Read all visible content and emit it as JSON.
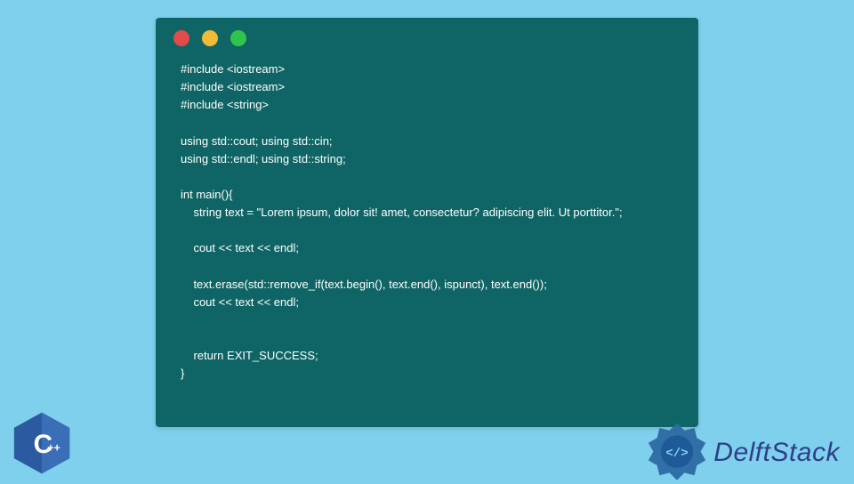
{
  "window": {
    "dot_colors": {
      "red": "#e24b4b",
      "yellow": "#f0bb36",
      "green": "#2fc54c"
    }
  },
  "code_lines": "#include <iostream>\n#include <iostream>\n#include <string>\n\nusing std::cout; using std::cin;\nusing std::endl; using std::string;\n\nint main(){\n    string text = \"Lorem ipsum, dolor sit! amet, consectetur? adipiscing elit. Ut porttitor.\";\n\n    cout << text << endl;\n\n    text.erase(std::remove_if(text.begin(), text.end(), ispunct), text.end());\n    cout << text << endl;\n\n\n    return EXIT_SUCCESS;\n}",
  "cpp_badge": {
    "label": "C++"
  },
  "delft": {
    "brand": "DelftStack"
  }
}
